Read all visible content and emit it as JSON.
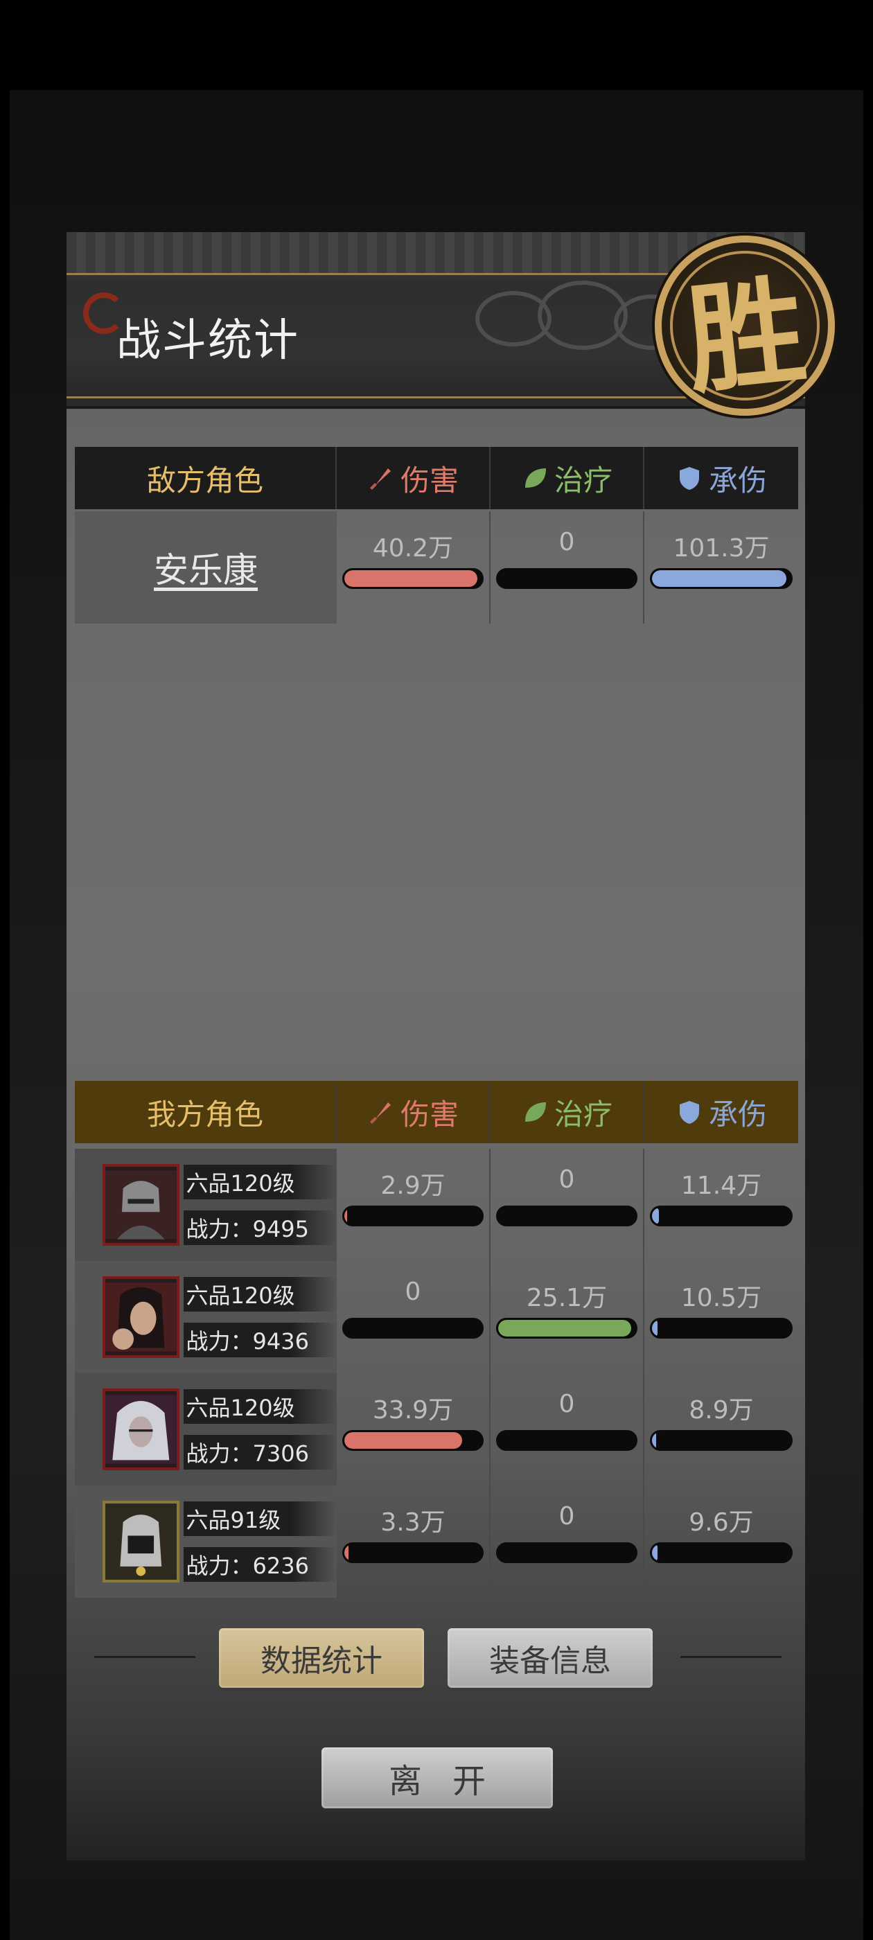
{
  "header": {
    "title": "战斗统计",
    "victory_glyph": "胜"
  },
  "enemy": {
    "label": "敌方角色",
    "metrics": {
      "damage": "伤害",
      "healing": "治疗",
      "tanked": "承伤"
    },
    "rows": [
      {
        "name": "安乐康",
        "damage": "40.2万",
        "damage_fill": 0.97,
        "healing": "0",
        "healing_fill": 0,
        "tanked": "101.3万",
        "tanked_fill": 0.97
      }
    ]
  },
  "ally": {
    "label": "我方角色",
    "metrics": {
      "damage": "伤害",
      "healing": "治疗",
      "tanked": "承伤"
    },
    "rows": [
      {
        "rank": "六品120级",
        "power": "战力：9495",
        "damage": "2.9万",
        "damage_fill": 0.02,
        "healing": "0",
        "healing_fill": 0,
        "tanked": "11.4万",
        "tanked_fill": 0.05
      },
      {
        "rank": "六品120级",
        "power": "战力：9436",
        "damage": "0",
        "damage_fill": 0,
        "healing": "25.1万",
        "healing_fill": 0.97,
        "tanked": "10.5万",
        "tanked_fill": 0.04
      },
      {
        "rank": "六品120级",
        "power": "战力：7306",
        "damage": "33.9万",
        "damage_fill": 0.86,
        "healing": "0",
        "healing_fill": 0,
        "tanked": "8.9万",
        "tanked_fill": 0.03
      },
      {
        "rank": "六品91级",
        "power": "战力：6236",
        "damage": "3.3万",
        "damage_fill": 0.03,
        "healing": "0",
        "healing_fill": 0,
        "tanked": "9.6万",
        "tanked_fill": 0.04
      }
    ]
  },
  "buttons": {
    "stats": "数据统计",
    "equipment": "装备信息",
    "leave": "离开"
  },
  "colors": {
    "damage": "#d8746a",
    "healing": "#7aa85a",
    "tanked": "#8aa8dc",
    "enemy_header": "#1c1c1c",
    "ally_header": "#503b0c",
    "gold_text": "#e6bd6b"
  }
}
